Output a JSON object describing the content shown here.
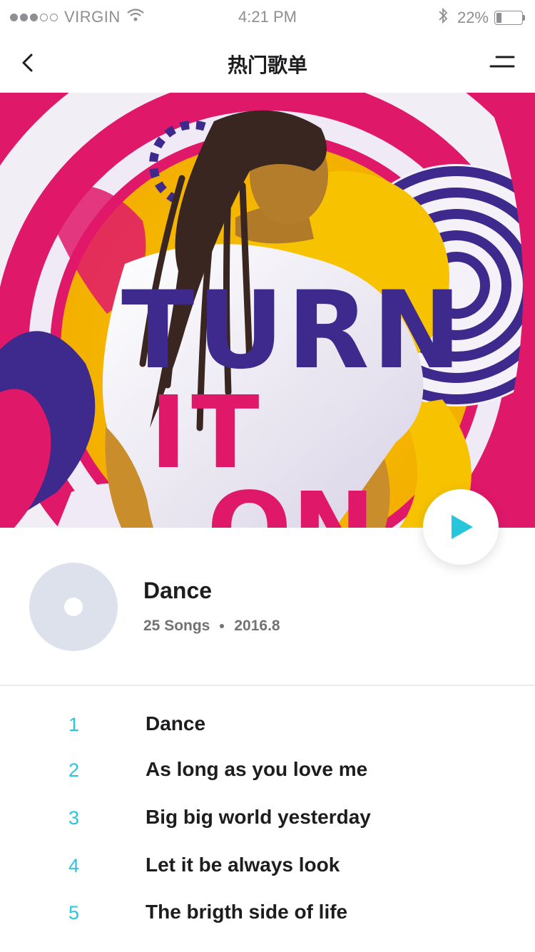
{
  "status_bar": {
    "carrier": "VIRGIN",
    "time": "4:21 PM",
    "battery": "22%",
    "battery_level": 0.22,
    "signal_bars": 3
  },
  "nav": {
    "title": "热门歌单",
    "back_icon": "chevron-left-icon",
    "menu_icon": "menu-icon"
  },
  "hero": {
    "artwork_text": "TURN IT ON",
    "colors": {
      "pink": "#e0186a",
      "yellow": "#f7c300",
      "purple": "#3d2a8c",
      "white": "#f4f2f8"
    }
  },
  "album": {
    "title": "Dance",
    "songs_count": "25 Songs",
    "date": "2016.8"
  },
  "accent_color": "#27c6dd",
  "songs": [
    {
      "number": "1",
      "title": "Dance"
    },
    {
      "number": "2",
      "title": "As long as you love me"
    },
    {
      "number": "3",
      "title": "Big big world yesterday"
    },
    {
      "number": "4",
      "title": "Let it be always look"
    },
    {
      "number": "5",
      "title": "The brigth side of life"
    }
  ]
}
